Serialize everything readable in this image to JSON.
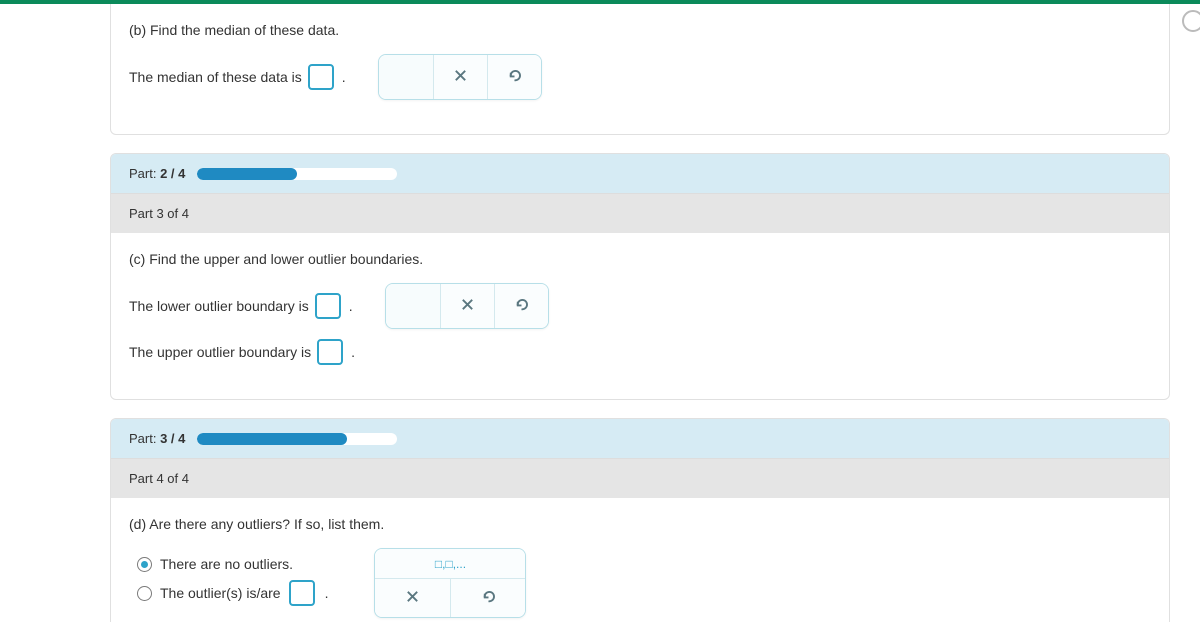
{
  "part_b": {
    "question": "(b) Find the median of these data.",
    "answer_prefix": "The median of these data is",
    "input_value": "",
    "period": "."
  },
  "progress2": {
    "label_prefix": "Part:",
    "label_value": "2 / 4",
    "fill_percent": 50
  },
  "part3": {
    "header": "Part 3 of 4",
    "question": "(c) Find the upper and lower outlier boundaries.",
    "lower_prefix": "The lower outlier boundary is",
    "upper_prefix": "The upper outlier boundary is",
    "lower_value": "",
    "upper_value": "",
    "period": "."
  },
  "progress3": {
    "label_prefix": "Part:",
    "label_value": "3 / 4",
    "fill_percent": 75
  },
  "part4": {
    "header": "Part 4 of 4",
    "question": "(d) Are there any outliers? If so, list them.",
    "option_none": "There are no outliers.",
    "option_list_prefix": "The outlier(s) is/are",
    "list_hint": "□,□,...",
    "outlier_value": "",
    "period": "."
  }
}
